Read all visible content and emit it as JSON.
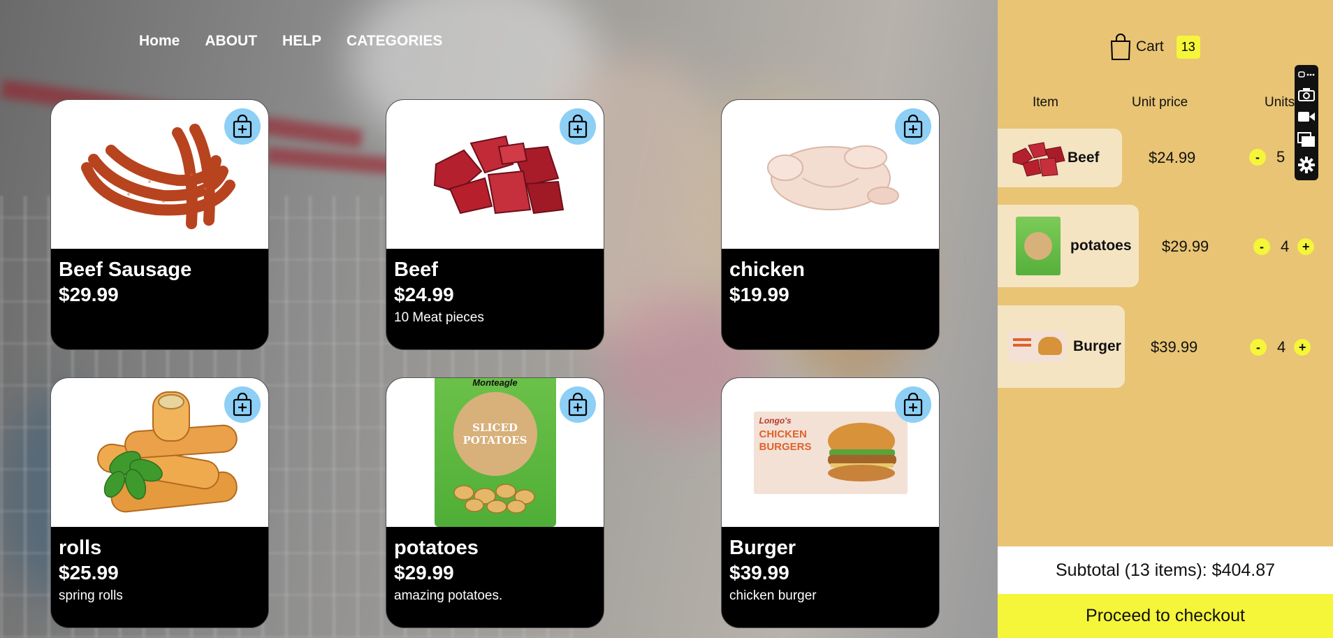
{
  "nav": {
    "home": "Home",
    "about": "ABOUT",
    "help": "HELP",
    "categories": "CATEGORIES"
  },
  "products": [
    {
      "name": "Beef Sausage",
      "price": "$29.99",
      "desc": ""
    },
    {
      "name": "Beef",
      "price": "$24.99",
      "desc": "10 Meat pieces"
    },
    {
      "name": "chicken",
      "price": "$19.99",
      "desc": ""
    },
    {
      "name": "rolls",
      "price": "$25.99",
      "desc": "spring rolls"
    },
    {
      "name": "potatoes",
      "price": "$29.99",
      "desc": "amazing potatoes."
    },
    {
      "name": "Burger",
      "price": "$39.99",
      "desc": "chicken burger"
    }
  ],
  "package_text": {
    "potatoes_brand": "Monteagle",
    "potatoes_title": "SLICED POTATOES",
    "burger_brand": "Longo's",
    "burger_title": "CHICKEN BURGERS"
  },
  "cart": {
    "label": "Cart",
    "count": "13",
    "columns": {
      "item": "Item",
      "unit_price": "Unit price",
      "units": "Units"
    },
    "items": [
      {
        "name": "Beef",
        "unit_price": "$24.99",
        "qty": "5"
      },
      {
        "name": "potatoes",
        "unit_price": "$29.99",
        "qty": "4"
      },
      {
        "name": "Burger",
        "unit_price": "$39.99",
        "qty": "4"
      }
    ],
    "minus": "-",
    "plus": "+",
    "subtotal": "Subtotal (13 items): $404.87",
    "checkout": "Proceed to checkout"
  },
  "colors": {
    "panel": "#e8c474",
    "accent": "#f5f53a",
    "add_button": "#8dcff5"
  }
}
